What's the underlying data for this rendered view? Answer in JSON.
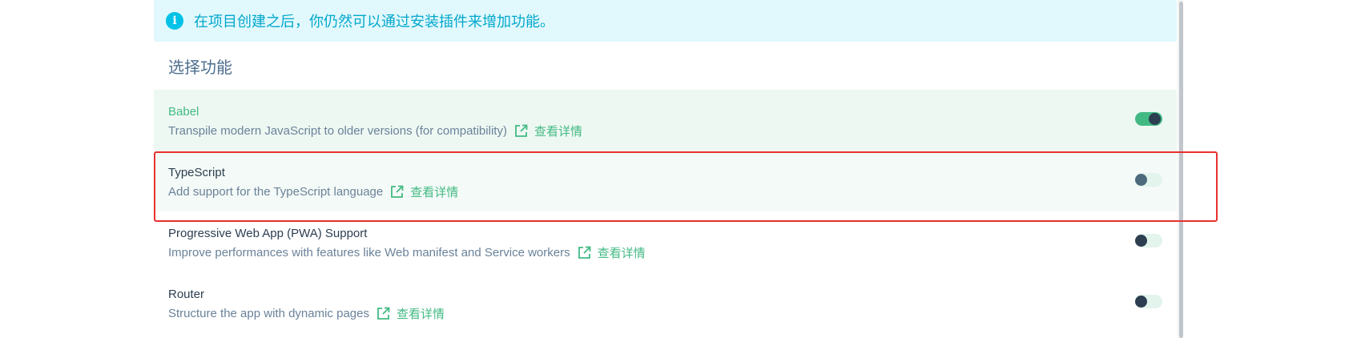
{
  "info_banner": {
    "icon": "info-icon",
    "icon_glyph": "i",
    "text": "在项目创建之后，你仍然可以通过安装插件来增加功能。"
  },
  "section_title": "选择功能",
  "features": [
    {
      "name": "Babel",
      "description": "Transpile modern JavaScript to older versions (for compatibility)",
      "link_label": "查看详情",
      "enabled": true
    },
    {
      "name": "TypeScript",
      "description": "Add support for the TypeScript language",
      "link_label": "查看详情",
      "enabled": false
    },
    {
      "name": "Progressive Web App (PWA) Support",
      "description": "Improve performances with features like Web manifest and Service workers",
      "link_label": "查看详情",
      "enabled": false
    },
    {
      "name": "Router",
      "description": "Structure the app with dynamic pages",
      "link_label": "查看详情",
      "enabled": false
    }
  ],
  "colors": {
    "accent": "#42b983",
    "info": "#03c2e6",
    "highlight": "#e8312f"
  }
}
